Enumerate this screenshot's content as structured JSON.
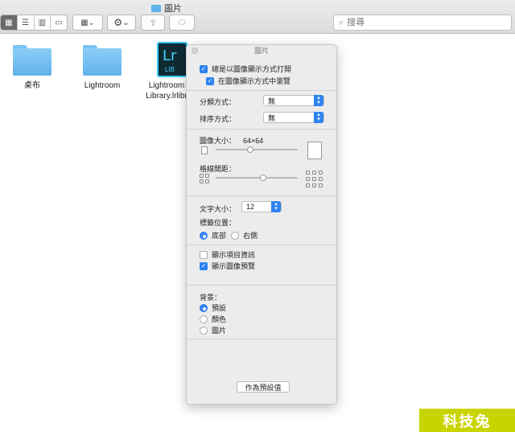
{
  "window": {
    "title": "圖片"
  },
  "toolbar": {
    "view_icon_mode": "icon-view-icon",
    "view_list_mode": "list-view-icon",
    "view_column_mode": "column-view-icon",
    "view_gallery_mode": "gallery-view-icon",
    "group_caret": "⌄",
    "action_caret": "⌄"
  },
  "search": {
    "placeholder": "搜尋"
  },
  "items": [
    {
      "label": "桌布"
    },
    {
      "label": "Lightroom"
    },
    {
      "label": "Lightroom Library.lrlibr",
      "badge_top": "Lr",
      "badge_bottom": "LIB"
    }
  ],
  "panel": {
    "title": "圖片",
    "always_open_label": "總是以圖像顯示方式打開",
    "browse_label": "在圖像顯示方式中瀏覽",
    "group_by_label": "分類方式：",
    "group_by_value": "無",
    "sort_by_label": "排序方式：",
    "sort_by_value": "無",
    "icon_size_label": "圖像大小：",
    "icon_size_value": "64×64",
    "grid_spacing_label": "格線間距：",
    "text_size_label": "文字大小：",
    "text_size_value": "12",
    "label_position_label": "標籤位置：",
    "label_bottom": "底部",
    "label_right": "右側",
    "show_item_info_label": "顯示項目資訊",
    "show_icon_preview_label": "顯示圖像預覽",
    "background_label": "背景：",
    "bg_default": "預設",
    "bg_color": "顏色",
    "bg_picture": "圖片",
    "use_defaults_button": "作為預設值",
    "icon_size_slider": 0.42,
    "grid_spacing_slider": 0.58
  },
  "watermark": {
    "text": "科技兔"
  },
  "colors": {
    "accent": "#2f83f1",
    "folder": "#5fb2ea",
    "watermark_bg": "#c8d400"
  }
}
